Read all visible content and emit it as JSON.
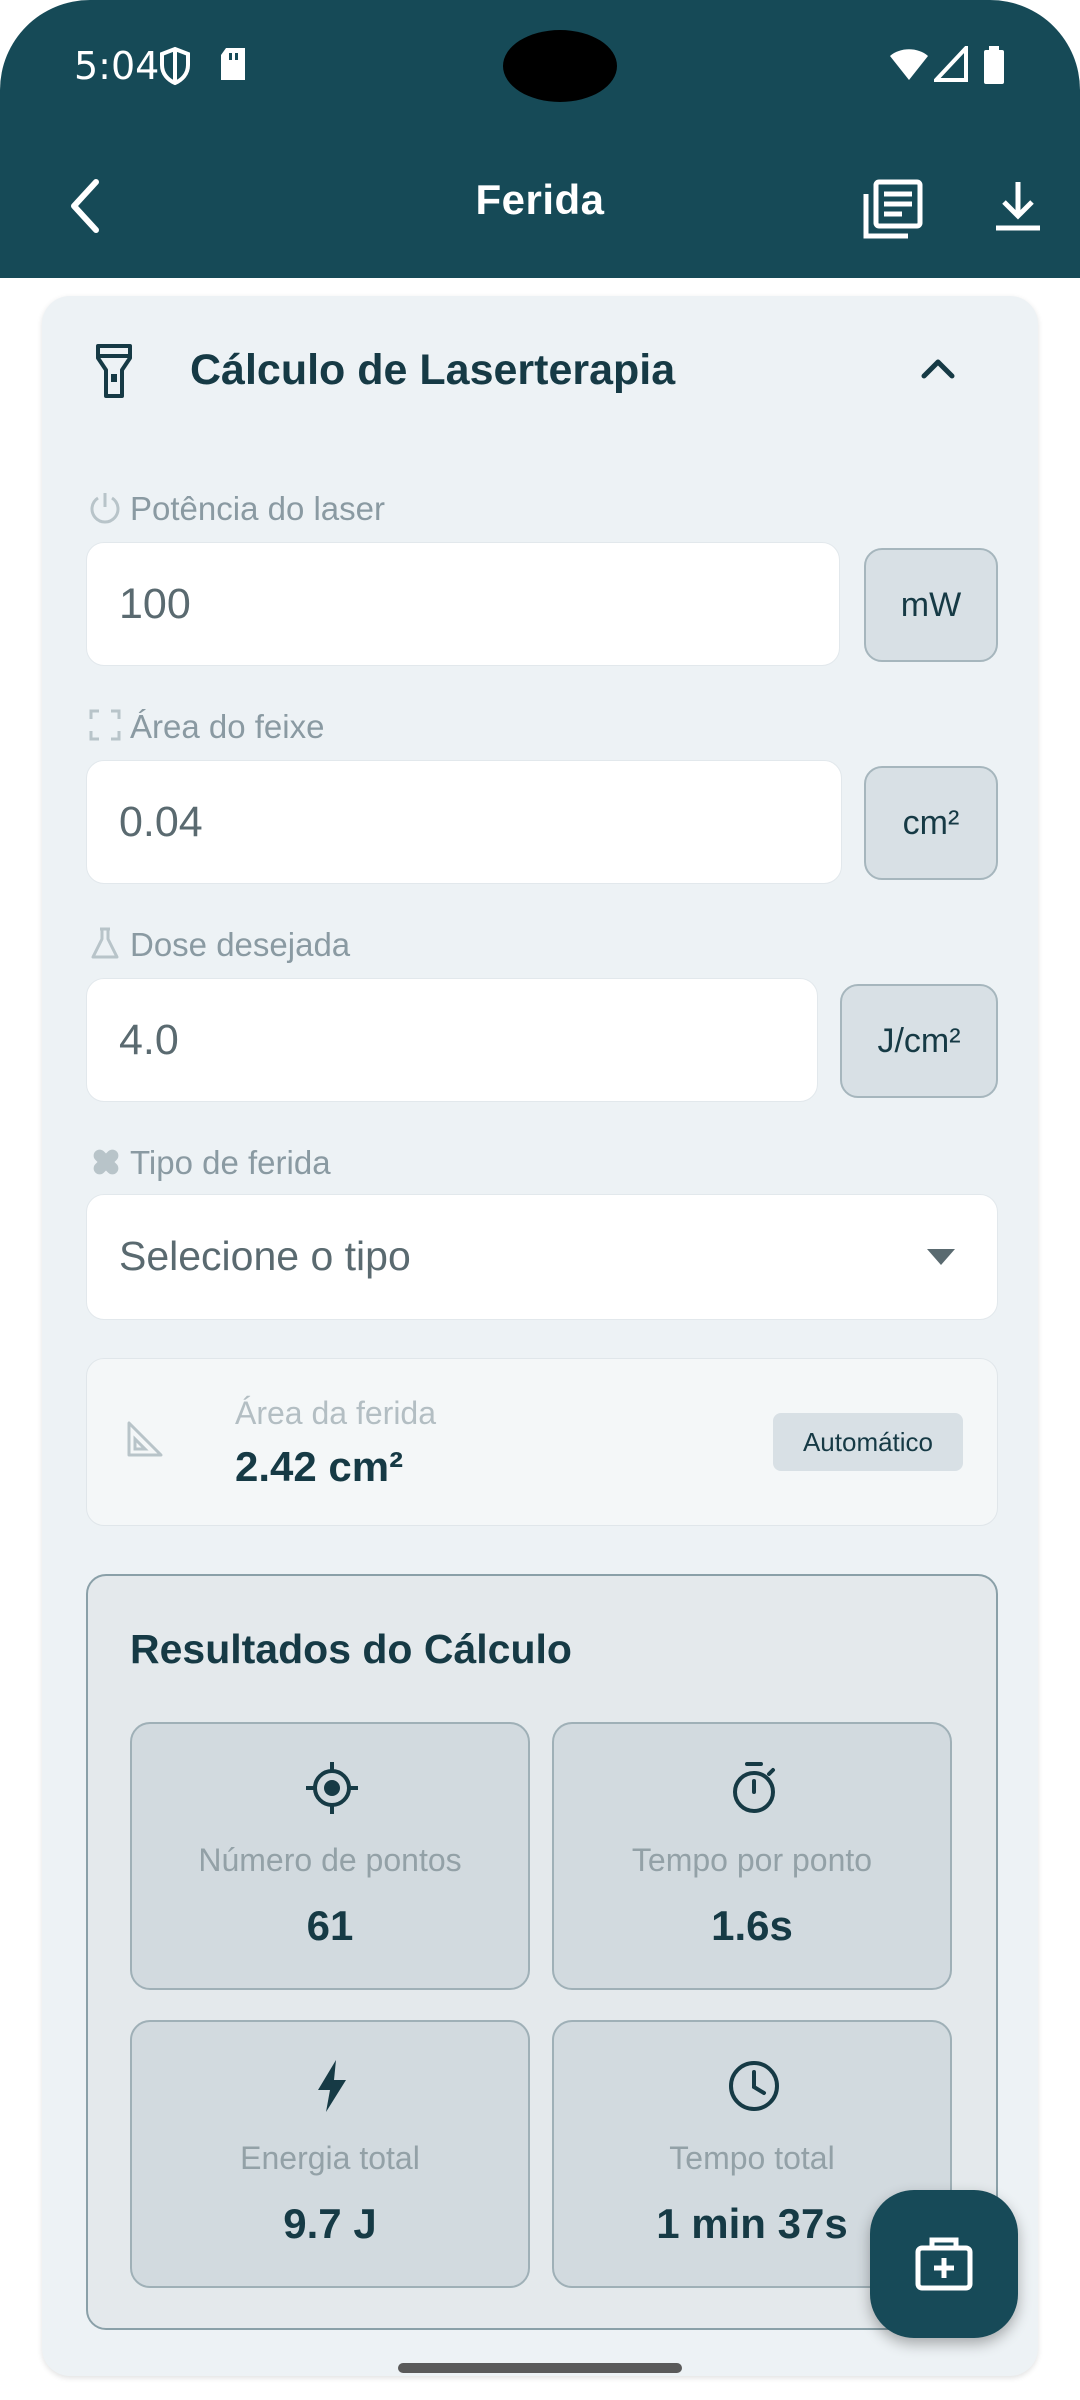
{
  "status_bar": {
    "time": "5:04"
  },
  "app_bar": {
    "title": "Ferida"
  },
  "section": {
    "title": "Cálculo de Laserterapia"
  },
  "fields": {
    "power": {
      "label": "Potência do laser",
      "value": "100",
      "unit": "mW"
    },
    "beam_area": {
      "label": "Área do feixe",
      "value": "0.04",
      "unit": "cm²"
    },
    "dose": {
      "label": "Dose desejada",
      "value": "4.0",
      "unit": "J/cm²"
    },
    "wound_type": {
      "label": "Tipo de ferida",
      "value": "Selecione o tipo"
    }
  },
  "wound_area": {
    "label": "Área da ferida",
    "value": "2.42 cm²",
    "badge": "Automático"
  },
  "results": {
    "title": "Resultados do Cálculo",
    "points": {
      "label": "Número de pontos",
      "value": "61",
      "icon": "target-icon"
    },
    "time_per_point": {
      "label": "Tempo por ponto",
      "value": "1.6s",
      "icon": "stopwatch-icon"
    },
    "total_energy": {
      "label": "Energia total",
      "value": "9.7 J",
      "icon": "bolt-icon"
    },
    "total_time": {
      "label": "Tempo total",
      "value": "1 min 37s",
      "icon": "clock-icon"
    }
  },
  "colors": {
    "primary": "#164a57",
    "card": "#edf2f5",
    "text": "#163a45"
  }
}
